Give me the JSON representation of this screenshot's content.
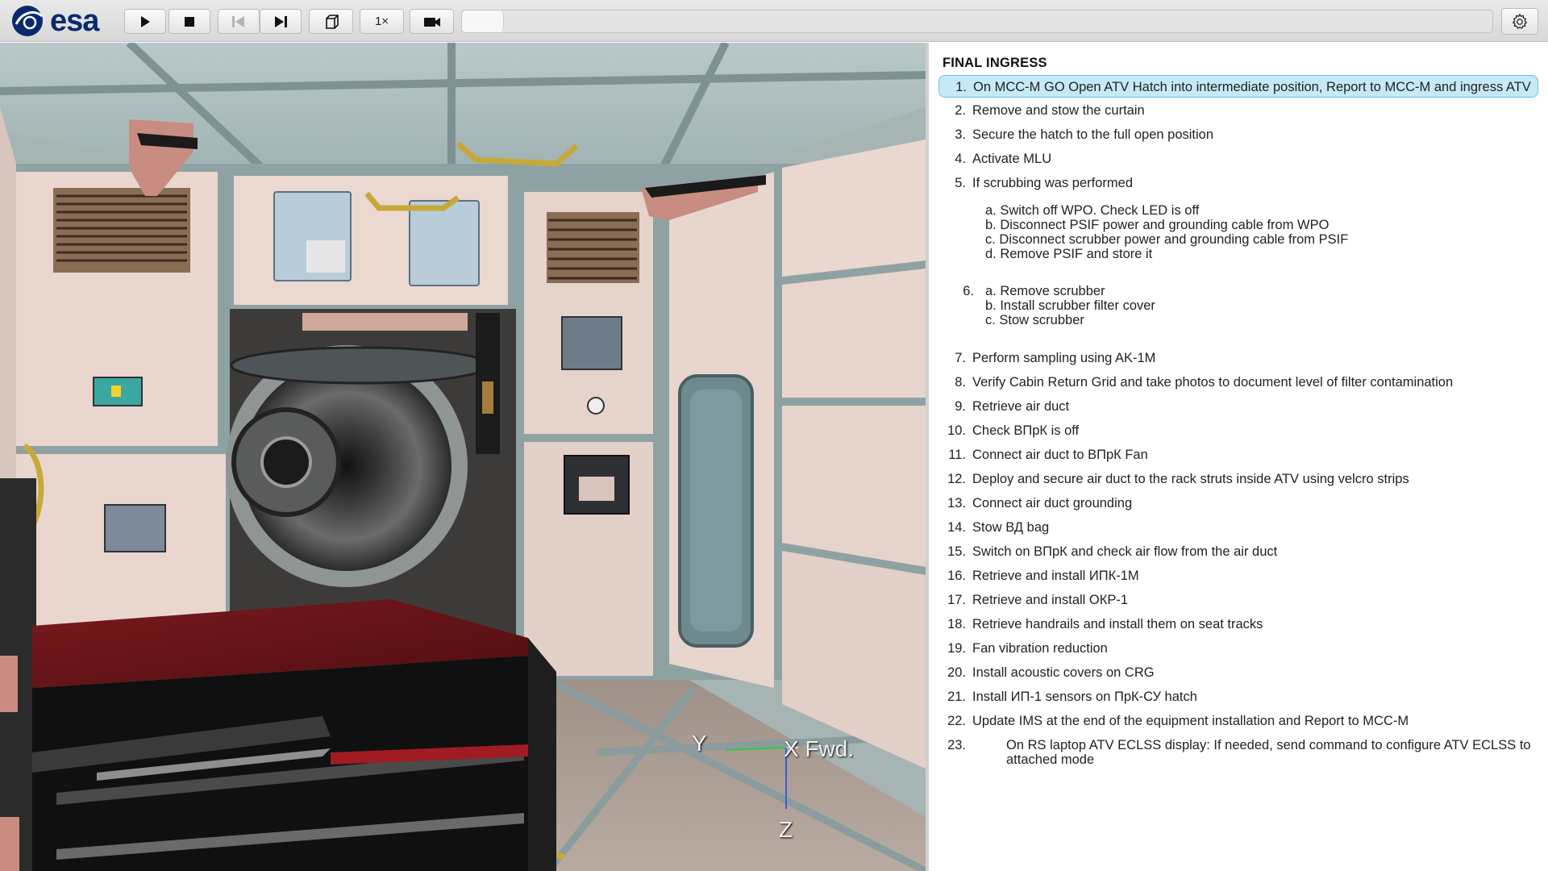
{
  "toolbar": {
    "logo_text": "esa",
    "buttons": [
      {
        "name": "play-button",
        "icon": "play-icon"
      },
      {
        "name": "stop-button",
        "icon": "stop-icon"
      },
      {
        "name": "previous-step-button",
        "icon": "skip-back-icon",
        "disabled": true
      },
      {
        "name": "next-step-button",
        "icon": "skip-forward-icon"
      },
      {
        "name": "view-cube-button",
        "icon": "cube-icon"
      },
      {
        "name": "speed-button",
        "label": "1×"
      },
      {
        "name": "camera-button",
        "icon": "video-camera-icon"
      }
    ],
    "speed_label": "1×",
    "progress_fraction": 0.0,
    "settings_icon": "gear-icon"
  },
  "viewport": {
    "axes": {
      "y": "Y",
      "x": "X Fwd.",
      "z": "Z"
    },
    "axis_colors": {
      "x": "#e6e6e6",
      "y": "#2ecc40",
      "z": "#3a5bd9"
    }
  },
  "procedure": {
    "title": "FINAL INGRESS",
    "steps": [
      {
        "n": "1.",
        "text": "On MCC-M GO Open ATV Hatch into intermediate position, Report to MCC-M and ingress ATV",
        "active": true
      },
      {
        "n": "2.",
        "text": "Remove and stow the curtain"
      },
      {
        "n": "3.",
        "text": "Secure the hatch to the full open position"
      },
      {
        "n": "4.",
        "text": "Activate MLU"
      },
      {
        "n": "5.",
        "text": "If scrubbing was performed",
        "sub": [
          "a. Switch off WPO. Check LED is off",
          "b. Disconnect PSIF power and grounding cable from WPO",
          "c. Disconnect scrubber power and grounding cable from PSIF",
          "d. Remove PSIF and store it"
        ]
      },
      {
        "n": "6.",
        "text": "",
        "sub": [
          "a. Remove scrubber",
          "b. Install scrubber filter cover",
          "c. Stow scrubber"
        ]
      },
      {
        "n": "7.",
        "text": "Perform sampling using AK-1M"
      },
      {
        "n": "8.",
        "text": "Verify Cabin Return Grid and take photos to document level of filter contamination"
      },
      {
        "n": "9.",
        "text": "Retrieve air duct"
      },
      {
        "n": "10.",
        "text": "Check ВПрК is off"
      },
      {
        "n": "11.",
        "text": "Connect air duct to ВПрК Fan"
      },
      {
        "n": "12.",
        "text": "Deploy and secure air duct to the rack struts inside ATV using velcro strips"
      },
      {
        "n": "13.",
        "text": "Connect air duct grounding"
      },
      {
        "n": "14.",
        "text": "Stow ВД bag"
      },
      {
        "n": "15.",
        "text": "Switch on ВПрК and check air flow from the air duct"
      },
      {
        "n": "16.",
        "text": "Retrieve and install ИПК-1М"
      },
      {
        "n": "17.",
        "text": "Retrieve and install ОКР-1"
      },
      {
        "n": "18.",
        "text": "Retrieve handrails and install them on seat tracks"
      },
      {
        "n": "19.",
        "text": "Fan vibration reduction"
      },
      {
        "n": "20.",
        "text": "Install acoustic covers on CRG"
      },
      {
        "n": "21.",
        "text": "Install ИП-1 sensors on ПрК-СУ hatch"
      },
      {
        "n": "22.",
        "text": "Update IMS at the end of the equipment installation and Report to MCC-M"
      },
      {
        "n": "23.",
        "text": "On RS laptop ATV ECLSS display: If needed, send command to configure ATV ECLSS to attached mode"
      }
    ]
  }
}
